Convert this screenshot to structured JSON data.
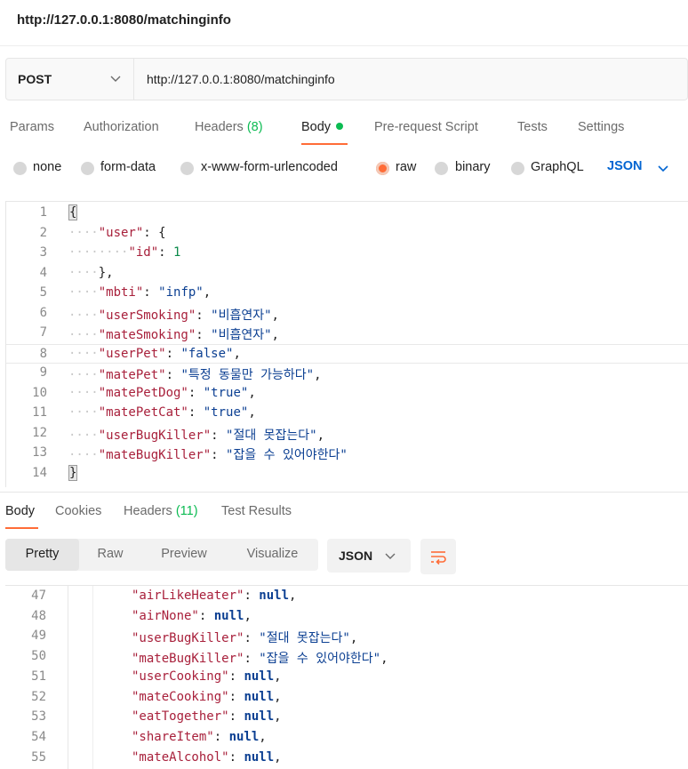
{
  "window": {
    "title": "http://127.0.0.1:8080/matchinginfo"
  },
  "request": {
    "method": "POST",
    "url": "http://127.0.0.1:8080/matchinginfo"
  },
  "request_tabs": {
    "params": "Params",
    "authorization": "Authorization",
    "headers": "Headers",
    "headers_count": "(8)",
    "body": "Body",
    "prerequest": "Pre-request Script",
    "tests": "Tests",
    "settings": "Settings"
  },
  "body_types": {
    "none": "none",
    "form_data": "form-data",
    "urlencoded": "x-www-form-urlencoded",
    "raw": "raw",
    "binary": "binary",
    "graphql": "GraphQL",
    "language": "JSON",
    "selected": "raw"
  },
  "request_body_lines": [
    {
      "n": "1",
      "ws": "",
      "text": "{"
    },
    {
      "n": "2",
      "ws": "····",
      "key": "\"user\"",
      "rest": ": {"
    },
    {
      "n": "3",
      "ws": "········",
      "key": "\"id\"",
      "rest": ": ",
      "num": "1"
    },
    {
      "n": "4",
      "ws": "····",
      "rest": "},"
    },
    {
      "n": "5",
      "ws": "····",
      "key": "\"mbti\"",
      "rest": ": ",
      "str": "\"infp\"",
      "tail": ","
    },
    {
      "n": "6",
      "ws": "····",
      "key": "\"userSmoking\"",
      "rest": ": ",
      "str": "\"비흡연자\"",
      "tail": ","
    },
    {
      "n": "7",
      "ws": "····",
      "key": "\"mateSmoking\"",
      "rest": ": ",
      "str": "\"비흡연자\"",
      "tail": ","
    },
    {
      "n": "8",
      "ws": "····",
      "key": "\"userPet\"",
      "rest": ": ",
      "str": "\"false\"",
      "tail": ","
    },
    {
      "n": "9",
      "ws": "····",
      "key": "\"matePet\"",
      "rest": ": ",
      "str": "\"특정 동물만 가능하다\"",
      "tail": ","
    },
    {
      "n": "10",
      "ws": "····",
      "key": "\"matePetDog\"",
      "rest": ": ",
      "str": "\"true\"",
      "tail": ","
    },
    {
      "n": "11",
      "ws": "····",
      "key": "\"matePetCat\"",
      "rest": ": ",
      "str": "\"true\"",
      "tail": ","
    },
    {
      "n": "12",
      "ws": "····",
      "key": "\"userBugKiller\"",
      "rest": ": ",
      "str": "\"절대 못잡는다\"",
      "tail": ","
    },
    {
      "n": "13",
      "ws": "····",
      "key": "\"mateBugKiller\"",
      "rest": ": ",
      "str": "\"잡을 수 있어야한다\"",
      "tail": ""
    },
    {
      "n": "14",
      "ws": "",
      "text": "}"
    }
  ],
  "response_tabs": {
    "body": "Body",
    "cookies": "Cookies",
    "headers": "Headers",
    "headers_count": "(11)",
    "test_results": "Test Results"
  },
  "response_view": {
    "pretty": "Pretty",
    "raw": "Raw",
    "preview": "Preview",
    "visualize": "Visualize",
    "format": "JSON"
  },
  "response_lines": [
    {
      "n": "47",
      "key": "\"airLikeHeater\"",
      "val": "null",
      "type": "null",
      "tail": ","
    },
    {
      "n": "48",
      "key": "\"airNone\"",
      "val": "null",
      "type": "null",
      "tail": ","
    },
    {
      "n": "49",
      "key": "\"userBugKiller\"",
      "val": "\"절대 못잡는다\"",
      "type": "str",
      "tail": ","
    },
    {
      "n": "50",
      "key": "\"mateBugKiller\"",
      "val": "\"잡을 수 있어야한다\"",
      "type": "str",
      "tail": ","
    },
    {
      "n": "51",
      "key": "\"userCooking\"",
      "val": "null",
      "type": "null",
      "tail": ","
    },
    {
      "n": "52",
      "key": "\"mateCooking\"",
      "val": "null",
      "type": "null",
      "tail": ","
    },
    {
      "n": "53",
      "key": "\"eatTogether\"",
      "val": "null",
      "type": "null",
      "tail": ","
    },
    {
      "n": "54",
      "key": "\"shareItem\"",
      "val": "null",
      "type": "null",
      "tail": ","
    },
    {
      "n": "55",
      "key": "\"mateAlcohol\"",
      "val": "null",
      "type": "null",
      "tail": ","
    }
  ],
  "colors": {
    "accent": "#ff6c37",
    "success": "#0cbb52",
    "link": "#0265d2",
    "json_key": "#a8203b",
    "json_string": "#0b3f92"
  }
}
